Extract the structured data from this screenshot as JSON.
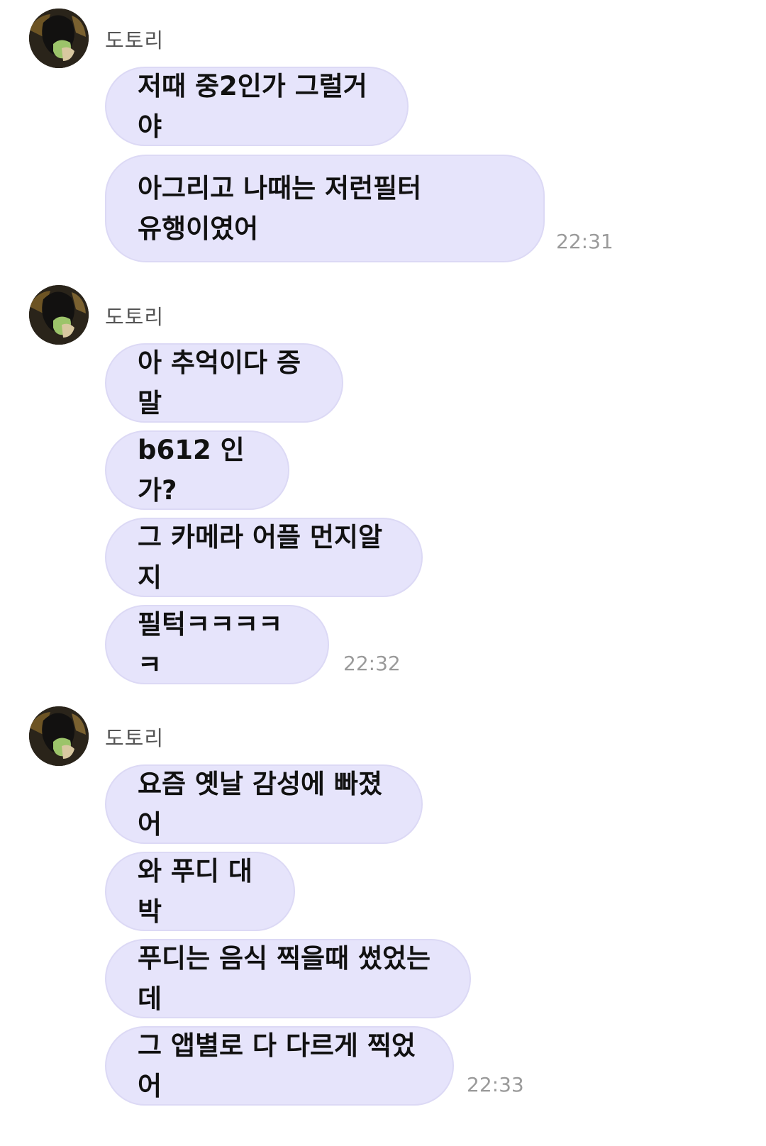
{
  "messages": [
    {
      "sender": "도토리",
      "bubbles": [
        "저때 중2인가 그럴거야",
        "아그리고 나때는 저런필터\n유행이였어"
      ],
      "time": "22:31"
    },
    {
      "sender": "도토리",
      "bubbles": [
        "아 추억이다 증말",
        "b612 인가?",
        "그 카메라 어플 먼지알지",
        "필턱ㅋㅋㅋㅋㅋ"
      ],
      "time": "22:32"
    },
    {
      "sender": "도토리",
      "bubbles": [
        "요즘 옛날 감성에 빠졌어",
        "와 푸디 대박",
        "푸디는 음식 찍을때 썼었는데",
        "그 앱별로 다 다르게 찍었어"
      ],
      "time": "22:33"
    }
  ],
  "colors": {
    "bubble_bg": "#e6e4fb",
    "bubble_border": "#dcd9f5",
    "sender_text": "#555555",
    "time_text": "#9a9a9a"
  },
  "icons": {
    "avatar": "profile-photo"
  }
}
